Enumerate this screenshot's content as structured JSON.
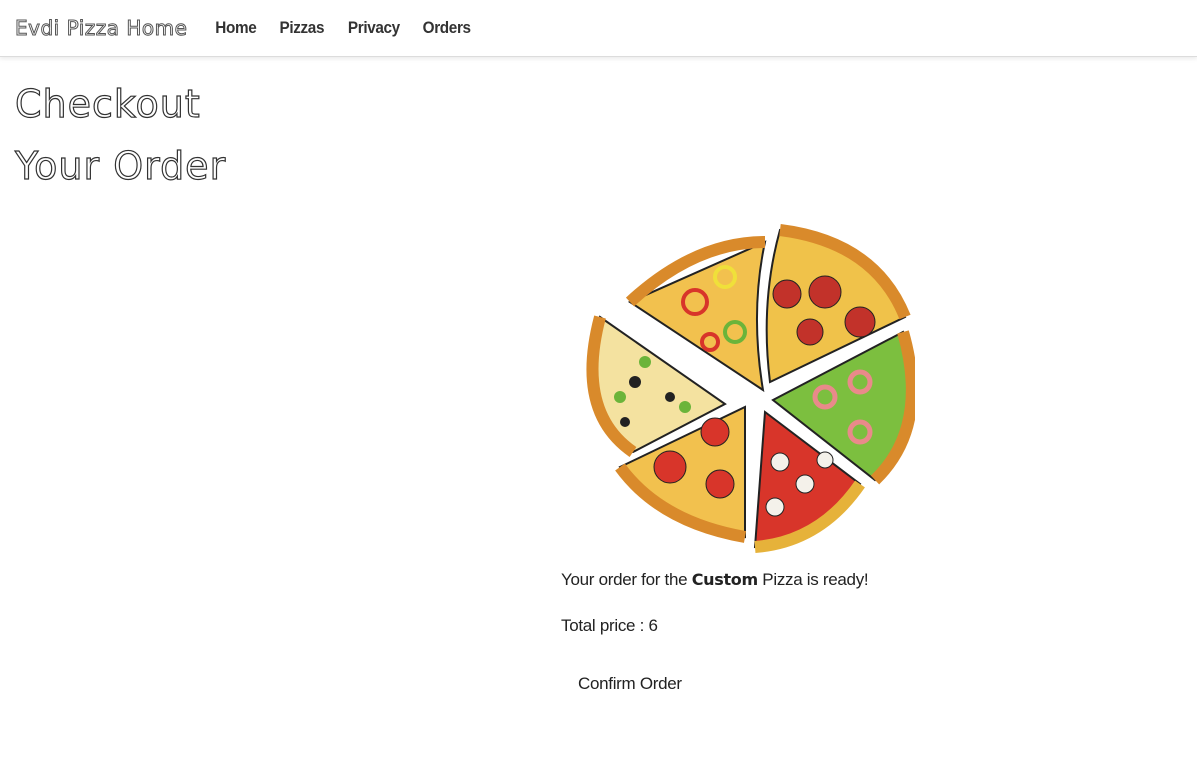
{
  "navbar": {
    "brand": "Evdi Pizza Home",
    "links": [
      "Home",
      "Pizzas",
      "Privacy",
      "Orders"
    ]
  },
  "page": {
    "title": "Checkout",
    "subtitle": "Your Order"
  },
  "order": {
    "message_prefix": "Your order for the ",
    "pizza_name": "Custom",
    "message_suffix": " Pizza is ready!",
    "total_label": "Total price : ",
    "total_value": "6",
    "confirm_label": "Confirm Order"
  },
  "image": {
    "icon": "pizza-illustration",
    "colors": {
      "crust": "#e39a3b",
      "sauce": "#d8352a",
      "cheese": "#f6d86a",
      "green": "#7cbf3f"
    }
  }
}
